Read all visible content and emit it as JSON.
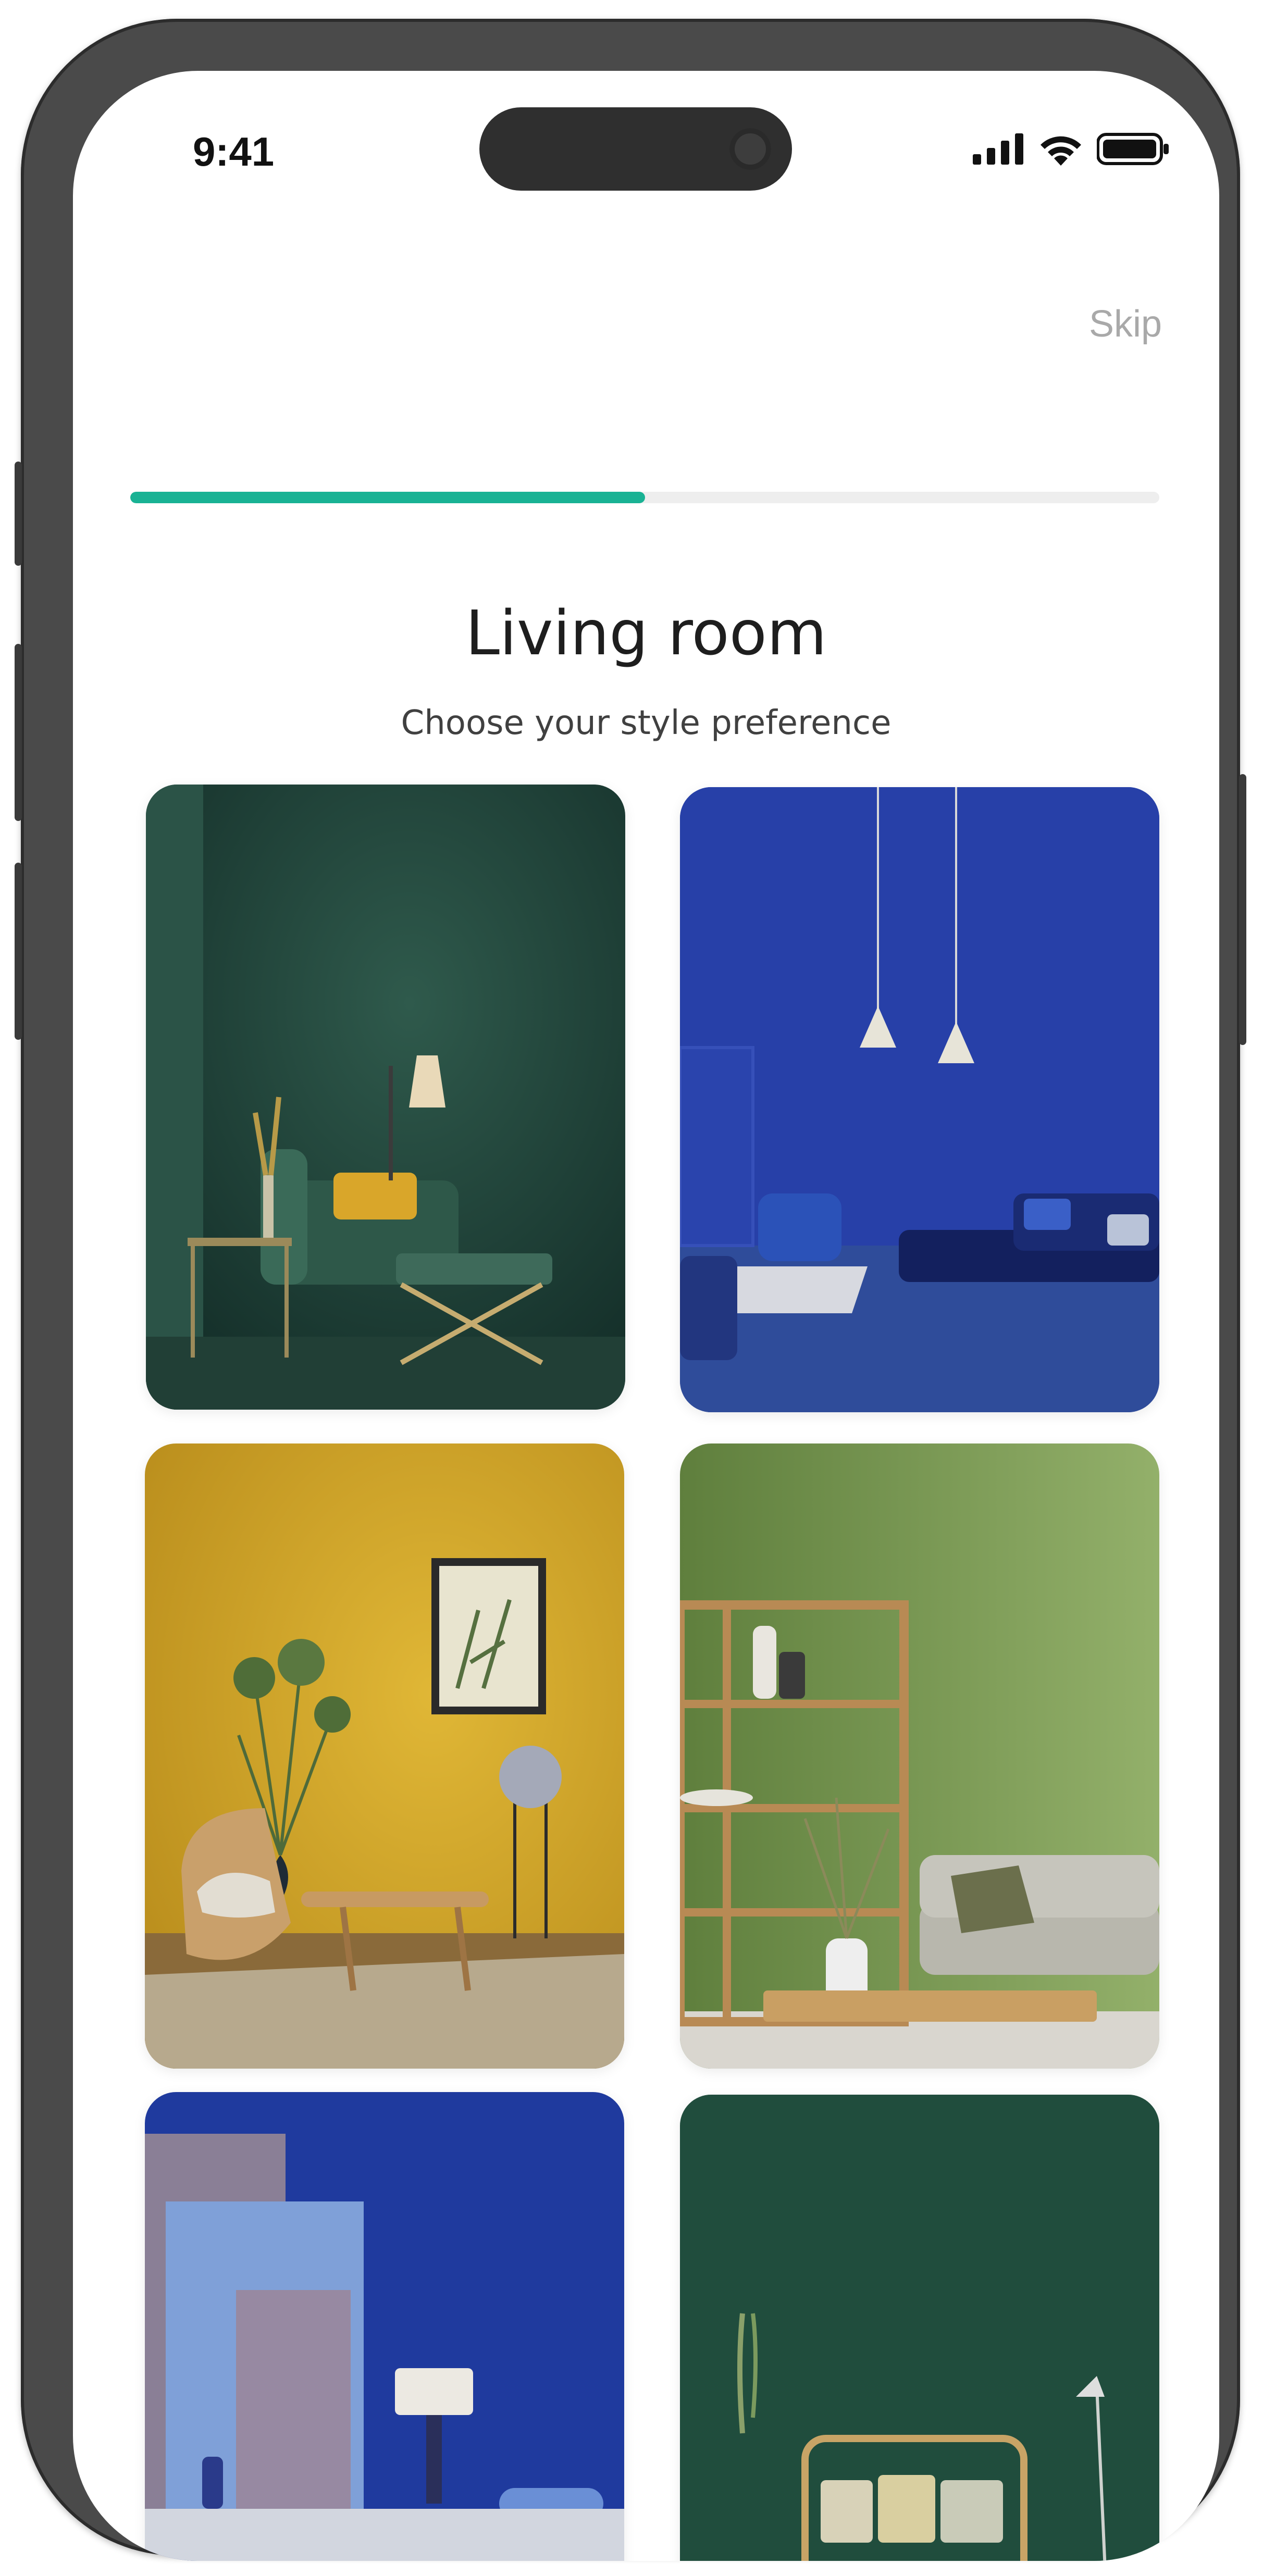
{
  "status": {
    "time": "9:41"
  },
  "header": {
    "skip_label": "Skip"
  },
  "progress": {
    "value": 0.5,
    "color": "#19b294"
  },
  "main": {
    "title": "Living room",
    "subtitle": "Choose your style preference"
  },
  "options": [
    {
      "name": "dark-green-room"
    },
    {
      "name": "blue-room"
    },
    {
      "name": "mustard-room"
    },
    {
      "name": "olive-room"
    },
    {
      "name": "navy-pastel-room"
    },
    {
      "name": "forest-green-room"
    }
  ]
}
